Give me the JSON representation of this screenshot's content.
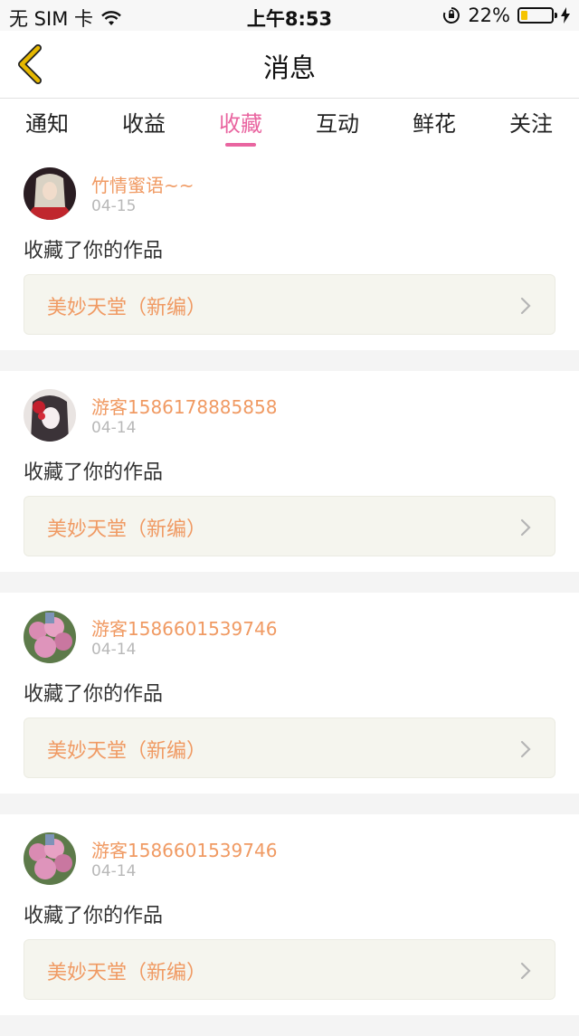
{
  "status_bar": {
    "carrier": "无 SIM 卡",
    "time": "上午8:53",
    "battery": "22%",
    "battery_level": 0.22,
    "battery_color": "#f5c400"
  },
  "nav": {
    "title": "消息",
    "back_icon": "chevron-left-icon",
    "accent": "#e6b800"
  },
  "tabs": [
    {
      "label": "通知",
      "active": false
    },
    {
      "label": "收益",
      "active": false
    },
    {
      "label": "收藏",
      "active": true
    },
    {
      "label": "互动",
      "active": false
    },
    {
      "label": "鲜花",
      "active": false
    },
    {
      "label": "关注",
      "active": false
    }
  ],
  "colors": {
    "accent_pink": "#e965a0",
    "name_orange": "#f09a63"
  },
  "items": [
    {
      "username": "竹情蜜语~~",
      "date": "04-15",
      "action": "收藏了你的作品",
      "work_title": "美妙天堂（新编）"
    },
    {
      "username": "游客1586178885858",
      "date": "04-14",
      "action": "收藏了你的作品",
      "work_title": "美妙天堂（新编）"
    },
    {
      "username": "游客1586601539746",
      "date": "04-14",
      "action": "收藏了你的作品",
      "work_title": "美妙天堂（新编）"
    },
    {
      "username": "游客1586601539746",
      "date": "04-14",
      "action": "收藏了你的作品",
      "work_title": "美妙天堂（新编）"
    }
  ]
}
